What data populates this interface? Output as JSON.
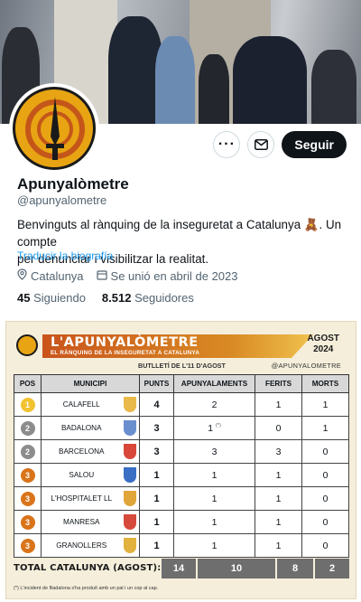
{
  "profile": {
    "name": "Apunyalòmetre",
    "handle": "@apunyalometre",
    "bio_line1": "Benvinguts al rànquing de la inseguretat a Catalunya 🧸. Un compte",
    "bio_line2": "per denunciar i visibilitzar la realitat.",
    "translate_label": "Traducir la biografía",
    "location": "Catalunya",
    "joined": "Se unió en abril de 2023",
    "following_count": "45",
    "following_label": "Siguiendo",
    "followers_count": "8.512",
    "followers_label": "Seguidores",
    "follow_label": "Seguir",
    "more_icon": "more-icon",
    "message_icon": "envelope-icon"
  },
  "card": {
    "title": "L'APUNYALÒMETRE",
    "subtitle": "EL RÀNQUING DE LA INSEGURETAT A CATALUNYA",
    "month": "AGOST",
    "year": "2024",
    "bulletin": "BUTLLETÍ DE L'11 D'AGOST",
    "handle": "@APUNYALOMETRE",
    "columns": [
      "POS",
      "MUNICIPI",
      "PUNTS",
      "APUNYALAMENTS",
      "FERITS",
      "MORTS"
    ],
    "rows": [
      {
        "pos": "1",
        "municipi": "CALAFELL",
        "punts": "4",
        "apunyalaments": "2",
        "note": "",
        "ferits": "1",
        "morts": "1",
        "badge_color": "#f2c230",
        "crest_color": "#e9b949"
      },
      {
        "pos": "2",
        "municipi": "BADALONA",
        "punts": "3",
        "apunyalaments": "1",
        "note": "(*)",
        "ferits": "0",
        "morts": "1",
        "badge_color": "#8c8c8c",
        "crest_color": "#6a8fcf"
      },
      {
        "pos": "2",
        "municipi": "BARCELONA",
        "punts": "3",
        "apunyalaments": "3",
        "note": "",
        "ferits": "3",
        "morts": "0",
        "badge_color": "#8c8c8c",
        "crest_color": "#d9473a"
      },
      {
        "pos": "3",
        "municipi": "SALOU",
        "punts": "1",
        "apunyalaments": "1",
        "note": "",
        "ferits": "1",
        "morts": "0",
        "badge_color": "#d9741a",
        "crest_color": "#3b6fc4"
      },
      {
        "pos": "3",
        "municipi": "L'HOSPITALET LL",
        "punts": "1",
        "apunyalaments": "1",
        "note": "",
        "ferits": "1",
        "morts": "0",
        "badge_color": "#d9741a",
        "crest_color": "#e0a63a"
      },
      {
        "pos": "3",
        "municipi": "MANRESA",
        "punts": "1",
        "apunyalaments": "1",
        "note": "",
        "ferits": "1",
        "morts": "0",
        "badge_color": "#d9741a",
        "crest_color": "#d64a3b"
      },
      {
        "pos": "3",
        "municipi": "GRANOLLERS",
        "punts": "1",
        "apunyalaments": "1",
        "note": "",
        "ferits": "1",
        "morts": "0",
        "badge_color": "#d9741a",
        "crest_color": "#e2b23e"
      }
    ],
    "total_label": "TOTAL CATALUNYA (AGOST):",
    "total_punts": "14",
    "total_apunyalaments": "10",
    "total_ferits": "8",
    "total_morts": "2",
    "footnote": "(*) L'incident de Badalona s'ha produït amb un pal i un cop al cap."
  }
}
